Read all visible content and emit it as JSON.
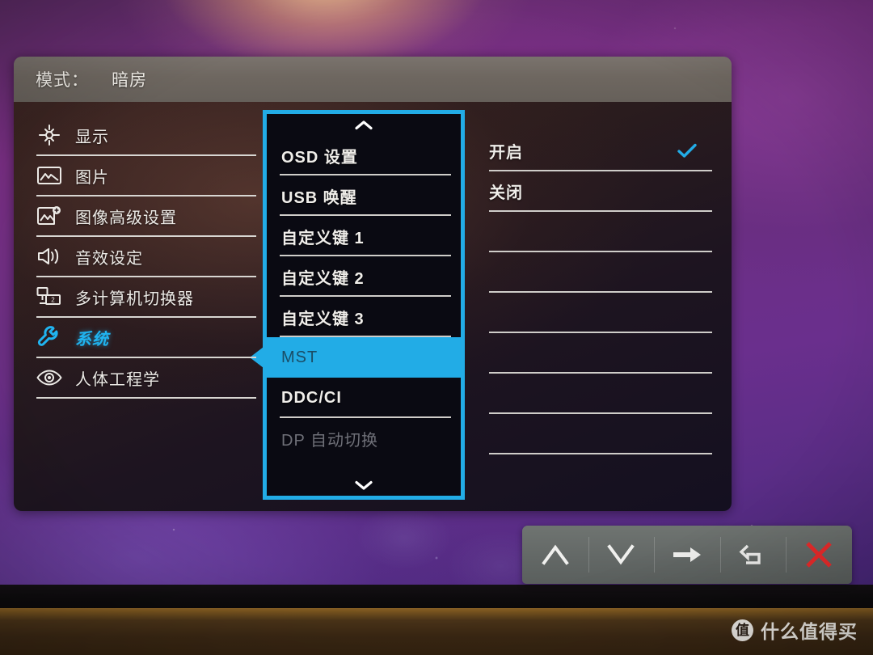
{
  "header": {
    "label": "模式：",
    "value": "暗房"
  },
  "sidebar": {
    "items": [
      {
        "label": "显示",
        "icon": "brightness-contrast-icon",
        "active": false
      },
      {
        "label": "图片",
        "icon": "picture-icon",
        "active": false
      },
      {
        "label": "图像高级设置",
        "icon": "picture-advanced-icon",
        "active": false
      },
      {
        "label": "音效设定",
        "icon": "speaker-icon",
        "active": false
      },
      {
        "label": "多计算机切换器",
        "icon": "kvm-switch-icon",
        "active": false
      },
      {
        "label": "系统",
        "icon": "wrench-icon",
        "active": true
      },
      {
        "label": "人体工程学",
        "icon": "eye-icon",
        "active": false
      }
    ]
  },
  "middle": {
    "scroll_up_icon": "chevron-up-icon",
    "scroll_down_icon": "chevron-down-icon",
    "items": [
      {
        "label": "OSD 设置",
        "selected": false,
        "dim": false
      },
      {
        "label": "USB 唤醒",
        "selected": false,
        "dim": false
      },
      {
        "label": "自定义键 1",
        "selected": false,
        "dim": false
      },
      {
        "label": "自定义键 2",
        "selected": false,
        "dim": false
      },
      {
        "label": "自定义键 3",
        "selected": false,
        "dim": false
      },
      {
        "label": "MST",
        "selected": true,
        "dim": true
      },
      {
        "label": "DDC/CI",
        "selected": false,
        "dim": false
      },
      {
        "label": "DP 自动切换",
        "selected": false,
        "dim": true
      }
    ]
  },
  "right": {
    "items": [
      {
        "label": "开启",
        "checked": true
      },
      {
        "label": "关闭",
        "checked": false
      },
      {
        "label": "",
        "checked": false
      },
      {
        "label": "",
        "checked": false
      },
      {
        "label": "",
        "checked": false
      },
      {
        "label": "",
        "checked": false
      },
      {
        "label": "",
        "checked": false
      },
      {
        "label": "",
        "checked": false
      }
    ],
    "check_icon": "check-icon"
  },
  "buttonbar": {
    "buttons": [
      {
        "name": "up-button",
        "icon": "chevron-up-icon"
      },
      {
        "name": "down-button",
        "icon": "chevron-down-icon"
      },
      {
        "name": "enter-button",
        "icon": "arrow-right-icon"
      },
      {
        "name": "back-button",
        "icon": "undo-arrow-icon"
      },
      {
        "name": "exit-button",
        "icon": "close-x-icon"
      }
    ]
  },
  "watermark": {
    "badge": "值",
    "text": "什么值得买"
  },
  "colors": {
    "accent_cyan": "#22ace6",
    "close_red": "#ef2b2b",
    "panel_header_gray": "#6e6760",
    "separator": "#cfcdc9"
  }
}
